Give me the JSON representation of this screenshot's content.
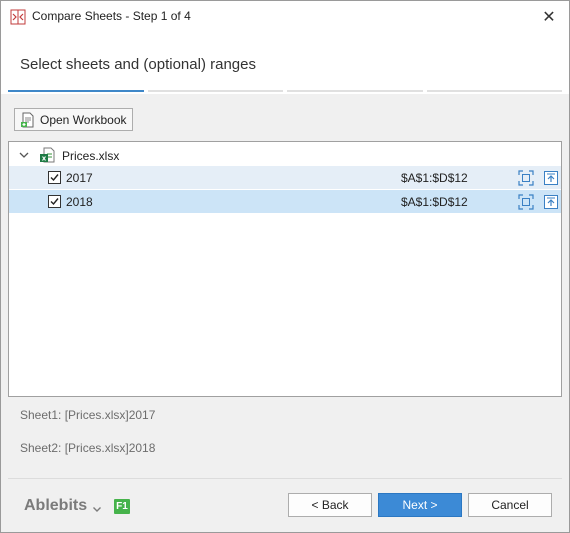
{
  "window": {
    "title": "Compare Sheets - Step 1 of 4",
    "close_glyph": "✕"
  },
  "header": {
    "step_title": "Select sheets and (optional) ranges",
    "steps_total": 4,
    "current_step": 1
  },
  "toolbar": {
    "open_workbook_label": "Open Workbook"
  },
  "tree": {
    "workbook": "Prices.xlsx",
    "sheets": [
      {
        "name": "2017",
        "checked": true,
        "range": "$A$1:$D$12",
        "selected": false
      },
      {
        "name": "2018",
        "checked": true,
        "range": "$A$1:$D$12",
        "selected": true
      }
    ]
  },
  "selection": {
    "sheet1": "Sheet1: [Prices.xlsx]2017",
    "sheet2": "Sheet2: [Prices.xlsx]2018"
  },
  "footer": {
    "brand": "Ablebits",
    "help_badge": "F1",
    "back_label": "< Back",
    "next_label": "Next >",
    "cancel_label": "Cancel"
  },
  "colors": {
    "accent": "#3e87c8",
    "next_button": "#3c8ad6",
    "help_badge": "#46b34b",
    "row_selected": "#cce4f7",
    "row_hover": "#e5eef7"
  }
}
